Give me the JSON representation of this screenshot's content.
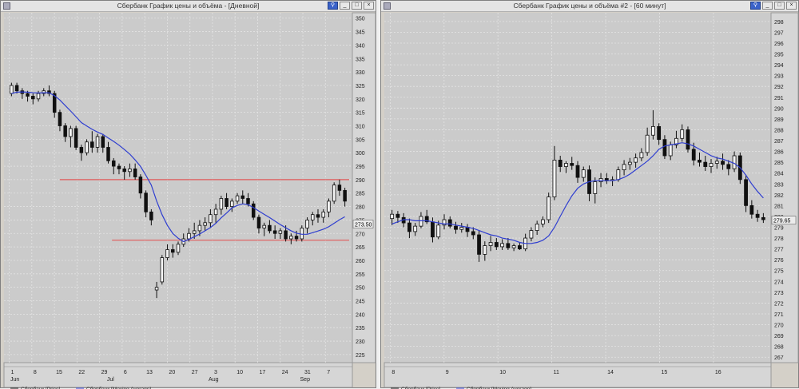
{
  "colors": {
    "plot_bg": "#cbcbcb",
    "grid": "#e4e4e4",
    "candle": "#101010",
    "ma": "#2f3ed0",
    "level": "#e05a5a",
    "axis_bg": "#d6d6d6"
  },
  "windows": [
    {
      "title": "Сбербанк График цены и объёма - [Дневной]",
      "legend": [
        "Сбербанк [Price]",
        "Сбербанк [Moving Average]"
      ],
      "last_price_label": "273.50",
      "y_ticks": [
        "350",
        "345",
        "340",
        "335",
        "330",
        "325",
        "320",
        "315",
        "310",
        "305",
        "300",
        "295",
        "290",
        "285",
        "280",
        "275",
        "270",
        "265",
        "260",
        "255",
        "250",
        "245",
        "240",
        "235",
        "230",
        "225"
      ],
      "x_ticks": [
        "1",
        "8",
        "15",
        "22",
        "29",
        "6",
        "13",
        "20",
        "27",
        "3",
        "10",
        "17",
        "24",
        "31",
        "7"
      ],
      "month_labels": [
        "Jun",
        "Jul",
        "Aug",
        "Sep"
      ]
    },
    {
      "title": "Сбербанк График цены и объёма #2 - [60 минут]",
      "legend": [
        "Сбербанк [Price]",
        "Сбербанк [Moving Average]"
      ],
      "last_price_label": "279.65",
      "y_ticks": [
        "298",
        "297",
        "296",
        "295",
        "294",
        "293",
        "292",
        "291",
        "290",
        "289",
        "288",
        "287",
        "286",
        "285",
        "284",
        "283",
        "282",
        "281",
        "280",
        "279",
        "278",
        "277",
        "276",
        "275",
        "274",
        "273",
        "272",
        "271",
        "270",
        "269",
        "268",
        "267"
      ],
      "x_ticks": [
        "8",
        "9",
        "10",
        "11",
        "14",
        "15",
        "16"
      ],
      "month_labels": []
    }
  ],
  "chart_data": [
    {
      "type": "candlestick",
      "title": "Сбербанк График цены и объёма - [Дневной]",
      "ylim": [
        222,
        352
      ],
      "series": [
        {
          "name": "Сбербанк [Price]",
          "ohlc": [
            [
              322,
              326,
              321,
              325
            ],
            [
              325,
              326,
              322,
              323
            ],
            [
              323,
              324,
              320,
              322
            ],
            [
              322,
              323,
              319,
              321
            ],
            [
              321,
              322,
              318,
              320
            ],
            [
              320,
              323,
              319,
              322
            ],
            [
              322,
              324,
              321,
              323
            ],
            [
              323,
              325,
              321,
              322
            ],
            [
              322,
              323,
              313,
              315
            ],
            [
              315,
              316,
              308,
              310
            ],
            [
              310,
              311,
              304,
              306
            ],
            [
              306,
              310,
              302,
              309
            ],
            [
              309,
              310,
              301,
              302
            ],
            [
              302,
              303,
              297,
              300
            ],
            [
              300,
              305,
              299,
              304
            ],
            [
              304,
              308,
              300,
              302
            ],
            [
              302,
              307,
              300,
              306
            ],
            [
              306,
              307,
              300,
              302
            ],
            [
              302,
              304,
              296,
              297
            ],
            [
              297,
              298,
              292,
              295
            ],
            [
              295,
              296,
              292,
              294
            ],
            [
              294,
              295,
              290,
              293
            ],
            [
              293,
              296,
              291,
              294
            ],
            [
              294,
              296,
              290,
              291
            ],
            [
              291,
              292,
              283,
              285
            ],
            [
              285,
              286,
              276,
              278
            ],
            [
              278,
              279,
              273,
              275
            ],
            [
              249,
              252,
              246,
              250
            ],
            [
              252,
              262,
              251,
              261
            ],
            [
              261,
              266,
              260,
              264
            ],
            [
              264,
              266,
              261,
              263
            ],
            [
              263,
              267,
              262,
              266
            ],
            [
              266,
              270,
              265,
              268
            ],
            [
              268,
              272,
              267,
              270
            ],
            [
              270,
              274,
              268,
              271
            ],
            [
              271,
              275,
              269,
              273
            ],
            [
              273,
              276,
              271,
              274
            ],
            [
              274,
              279,
              272,
              277
            ],
            [
              277,
              281,
              274,
              279
            ],
            [
              279,
              284,
              277,
              283
            ],
            [
              283,
              285,
              279,
              280
            ],
            [
              280,
              283,
              278,
              282
            ],
            [
              282,
              285,
              281,
              284
            ],
            [
              284,
              286,
              281,
              283
            ],
            [
              283,
              285,
              280,
              281
            ],
            [
              281,
              282,
              275,
              276
            ],
            [
              276,
              277,
              270,
              272
            ],
            [
              272,
              274,
              269,
              273
            ],
            [
              273,
              275,
              270,
              271
            ],
            [
              271,
              273,
              268,
              270
            ],
            [
              270,
              272,
              268,
              271
            ],
            [
              271,
              273,
              267,
              268
            ],
            [
              268,
              270,
              266,
              269
            ],
            [
              269,
              271,
              267,
              268
            ],
            [
              268,
              273,
              267,
              272
            ],
            [
              272,
              276,
              270,
              275
            ],
            [
              275,
              278,
              273,
              277
            ],
            [
              277,
              279,
              274,
              276
            ],
            [
              276,
              279,
              274,
              278
            ],
            [
              278,
              283,
              276,
              282
            ],
            [
              282,
              289,
              281,
              288
            ],
            [
              288,
              290,
              284,
              286
            ],
            [
              286,
              287,
              280,
              282
            ]
          ]
        },
        {
          "name": "Сбербанк [Moving Average]",
          "values": [
            322,
            322.5,
            322.6,
            322.5,
            322.3,
            322.2,
            322.3,
            322.3,
            321.2,
            319.6,
            317.5,
            315.5,
            313.4,
            311.2,
            309.9,
            308.7,
            307.7,
            306.8,
            305.5,
            304.2,
            302.8,
            301.2,
            299.5,
            297.3,
            294.9,
            291.6,
            288.0,
            282.0,
            277.0,
            273.0,
            270.0,
            268.2,
            267.0,
            267.8,
            268.8,
            269.8,
            271.0,
            272.2,
            273.8,
            275.8,
            277.6,
            279.5,
            280.4,
            281.0,
            280.7,
            279.6,
            278.3,
            277.1,
            275.9,
            274.6,
            273.3,
            272.1,
            271.0,
            270.1,
            269.7,
            269.7,
            270.3,
            270.9,
            271.6,
            272.5,
            273.8,
            275.1,
            276.2
          ]
        }
      ],
      "levels": [
        290,
        267.5
      ],
      "last_price": 273.5
    },
    {
      "type": "candlestick",
      "title": "Сбербанк График цены и объёма #2 - [60 минут]",
      "ylim": [
        266.5,
        298.8
      ],
      "series": [
        {
          "name": "Сбербанк [Price]",
          "ohlc": [
            [
              279.8,
              280.6,
              279.2,
              280.2
            ],
            [
              280.2,
              280.5,
              279.4,
              279.9
            ],
            [
              279.9,
              280.3,
              279.0,
              279.4
            ],
            [
              279.4,
              279.8,
              278.0,
              278.6
            ],
            [
              278.6,
              279.4,
              278.2,
              279.1
            ],
            [
              279.1,
              280.4,
              278.9,
              280.0
            ],
            [
              280.0,
              280.6,
              279.3,
              279.5
            ],
            [
              279.5,
              279.9,
              277.6,
              278.1
            ],
            [
              278.1,
              279.6,
              277.9,
              279.2
            ],
            [
              279.2,
              280.2,
              278.8,
              279.7
            ],
            [
              279.7,
              280.0,
              278.9,
              279.1
            ],
            [
              279.1,
              279.5,
              278.4,
              278.8
            ],
            [
              278.8,
              279.4,
              278.5,
              279.0
            ],
            [
              279.0,
              279.3,
              278.1,
              278.6
            ],
            [
              278.6,
              279.0,
              277.9,
              278.3
            ],
            [
              278.3,
              278.7,
              275.8,
              276.5
            ],
            [
              276.5,
              277.7,
              275.9,
              277.3
            ],
            [
              277.3,
              278.2,
              276.8,
              277.6
            ],
            [
              277.6,
              278.0,
              276.9,
              277.2
            ],
            [
              277.2,
              277.9,
              276.9,
              277.5
            ],
            [
              277.5,
              278.0,
              276.9,
              277.1
            ],
            [
              277.1,
              277.5,
              276.8,
              277.3
            ],
            [
              277.3,
              277.6,
              276.9,
              277.0
            ],
            [
              277.0,
              278.4,
              276.8,
              278.0
            ],
            [
              278.0,
              279.0,
              277.7,
              278.7
            ],
            [
              278.7,
              279.6,
              278.3,
              279.3
            ],
            [
              279.3,
              280.0,
              279.0,
              279.7
            ],
            [
              279.7,
              282.2,
              279.4,
              281.8
            ],
            [
              281.8,
              286.5,
              281.5,
              285.2
            ],
            [
              285.2,
              285.6,
              284.1,
              284.6
            ],
            [
              284.6,
              285.1,
              284.0,
              284.9
            ],
            [
              284.9,
              285.5,
              284.3,
              284.7
            ],
            [
              284.7,
              285.1,
              283.1,
              283.6
            ],
            [
              283.6,
              284.6,
              283.2,
              284.3
            ],
            [
              284.3,
              284.7,
              281.4,
              282.1
            ],
            [
              282.1,
              283.6,
              281.2,
              283.2
            ],
            [
              283.2,
              284.0,
              282.7,
              283.5
            ],
            [
              283.5,
              284.0,
              283.0,
              283.3
            ],
            [
              283.3,
              283.7,
              282.8,
              283.4
            ],
            [
              283.4,
              284.6,
              283.2,
              284.3
            ],
            [
              284.3,
              285.2,
              283.8,
              284.8
            ],
            [
              284.8,
              285.4,
              284.3,
              285.0
            ],
            [
              285.0,
              285.8,
              284.5,
              285.4
            ],
            [
              285.4,
              286.3,
              285.1,
              285.9
            ],
            [
              285.9,
              288.2,
              285.6,
              287.5
            ],
            [
              287.5,
              289.8,
              287.1,
              288.3
            ],
            [
              288.3,
              288.6,
              286.6,
              287.1
            ],
            [
              287.1,
              287.5,
              285.3,
              285.6
            ],
            [
              285.6,
              286.9,
              285.2,
              286.6
            ],
            [
              286.6,
              287.9,
              286.3,
              287.2
            ],
            [
              287.2,
              288.5,
              286.9,
              288.0
            ],
            [
              288.0,
              288.3,
              285.9,
              286.2
            ],
            [
              286.2,
              286.8,
              284.7,
              285.2
            ],
            [
              285.2,
              285.9,
              284.6,
              285.0
            ],
            [
              285.0,
              285.6,
              284.2,
              284.6
            ],
            [
              284.6,
              285.3,
              284.0,
              284.9
            ],
            [
              284.9,
              285.5,
              284.4,
              285.1
            ],
            [
              285.1,
              285.8,
              284.3,
              284.8
            ],
            [
              284.8,
              285.2,
              283.8,
              284.4
            ],
            [
              284.4,
              286.0,
              284.1,
              285.6
            ],
            [
              285.6,
              285.9,
              283.0,
              283.4
            ],
            [
              283.4,
              283.8,
              280.4,
              281.0
            ],
            [
              281.0,
              281.5,
              279.8,
              280.2
            ],
            [
              280.2,
              280.6,
              279.5,
              279.9
            ],
            [
              279.9,
              280.3,
              279.4,
              279.7
            ]
          ]
        },
        {
          "name": "Сбербанк [Moving Average]",
          "values": [
            279.3,
            279.5,
            279.7,
            279.7,
            279.6,
            279.6,
            279.6,
            279.5,
            279.4,
            279.3,
            279.3,
            279.2,
            279.1,
            279.0,
            278.9,
            278.7,
            278.5,
            278.3,
            278.2,
            278.0,
            277.9,
            277.8,
            277.6,
            277.5,
            277.5,
            277.6,
            277.8,
            278.2,
            279.0,
            280.0,
            281.0,
            281.9,
            282.6,
            283.0,
            283.2,
            283.3,
            283.3,
            283.3,
            283.3,
            283.4,
            283.6,
            283.9,
            284.3,
            284.7,
            285.1,
            285.6,
            286.2,
            286.5,
            286.6,
            286.7,
            286.8,
            286.7,
            286.5,
            286.2,
            285.9,
            285.6,
            285.4,
            285.3,
            285.1,
            284.9,
            284.5,
            283.8,
            283.0,
            282.3,
            281.7
          ]
        }
      ],
      "last_price": 279.65
    }
  ]
}
